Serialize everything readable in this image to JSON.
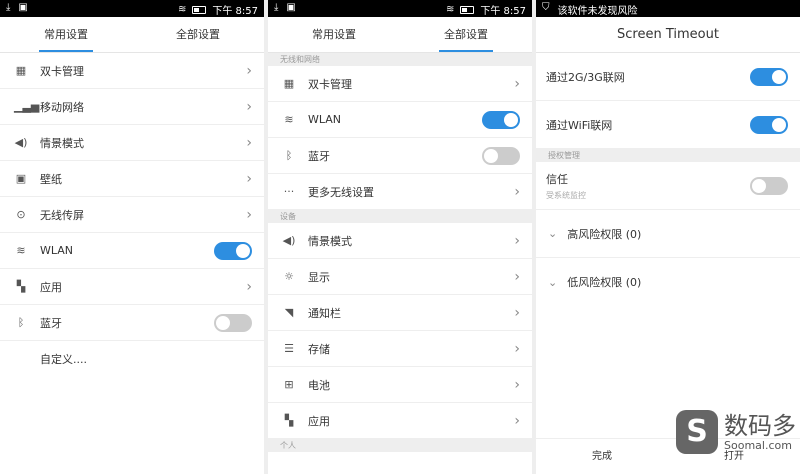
{
  "status": {
    "time": "下午 8:57",
    "notice": "该软件未发现风险"
  },
  "tabs": {
    "common": "常用设置",
    "all": "全部设置"
  },
  "panel1": {
    "items": [
      {
        "label": "双卡管理",
        "icon": "sim-card-icon"
      },
      {
        "label": "移动网络",
        "icon": "signal-icon"
      },
      {
        "label": "情景模式",
        "icon": "volume-icon"
      },
      {
        "label": "壁纸",
        "icon": "image-icon"
      },
      {
        "label": "无线传屏",
        "icon": "cast-icon"
      },
      {
        "label": "WLAN",
        "icon": "wifi-icon",
        "toggle": true
      },
      {
        "label": "应用",
        "icon": "apps-icon"
      },
      {
        "label": "蓝牙",
        "icon": "bluetooth-icon",
        "toggle": false
      }
    ],
    "custom": "自定义...."
  },
  "panel2": {
    "section_wireless": "无线和网络",
    "wireless": [
      {
        "label": "双卡管理",
        "icon": "sim-card-icon"
      },
      {
        "label": "WLAN",
        "icon": "wifi-icon",
        "toggle": true
      },
      {
        "label": "蓝牙",
        "icon": "bluetooth-icon",
        "toggle": false
      },
      {
        "label": "更多无线设置",
        "icon": "more-icon"
      }
    ],
    "section_device": "设备",
    "device": [
      {
        "label": "情景模式",
        "icon": "volume-icon"
      },
      {
        "label": "显示",
        "icon": "brightness-icon"
      },
      {
        "label": "通知栏",
        "icon": "notification-icon"
      },
      {
        "label": "存储",
        "icon": "storage-icon"
      },
      {
        "label": "电池",
        "icon": "battery-icon"
      },
      {
        "label": "应用",
        "icon": "apps-icon"
      }
    ],
    "section_personal": "个人"
  },
  "panel3": {
    "title": "Screen Timeout",
    "network_2g3g": "通过2G/3G联网",
    "network_wifi": "通过WiFi联网",
    "section_perm": "授权管理",
    "trust": "信任",
    "trust_sub": "受系统监控",
    "high_risk": "高风险权限 (0)",
    "low_risk": "低风险权限 (0)",
    "done": "完成",
    "open": "打开"
  },
  "watermark": {
    "brand": "数码多",
    "site": "Soomal.com"
  },
  "colors": {
    "accent": "#2d8ee0"
  }
}
